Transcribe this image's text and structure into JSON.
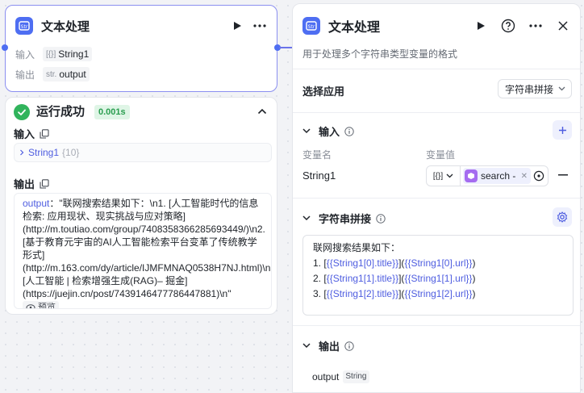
{
  "colors": {
    "accent": "#4e6ef2",
    "success": "#31b45c",
    "plugin": "#a56cf0"
  },
  "node": {
    "title": "文本处理",
    "input_label": "输入",
    "input_type": "[{}]",
    "input_value": "String1",
    "output_label": "输出",
    "output_type": "str.",
    "output_value": "output"
  },
  "result": {
    "status": "运行成功",
    "duration": "0.001s",
    "input_title": "输入",
    "input_key": "String1",
    "input_count": "{10}",
    "output_title": "输出",
    "output_key": "output",
    "output_sep": "：",
    "output_value": "\"联网搜索结果如下：\\n1. [人工智能时代的信息检索: 应用现状、现实挑战与应对策略](http://m.toutiao.com/group/7408358366285693449/)\\n2. [基于教育元宇宙的AI人工智能检索平台变革了传统教学形式](http://m.163.com/dy/article/IJMFMNAQ0538H7NJ.html)\\n3. [人工智能 | 检索增强生成(RAG)– 掘金](https://juejin.cn/post/7439146477786447881)\\n\"",
    "preview_label": "预览"
  },
  "panel": {
    "title": "文本处理",
    "description": "用于处理多个字符串类型变量的格式",
    "apply_label": "选择应用",
    "apply_value": "字符串拼接",
    "input_section": "输入",
    "col_name": "变量名",
    "col_value": "变量值",
    "var_name": "String1",
    "var_type": "[{}]",
    "var_ref": "search - out",
    "concat_section": "字符串拼接",
    "template": [
      {
        "pre": "联网搜索结果如下：",
        "v1": "",
        "mid": "",
        "v2": "",
        "post": ""
      },
      {
        "pre": "1. [",
        "v1": "{{String1[0].title}}",
        "mid": "](",
        "v2": "{{String1[0].url}}",
        "post": ")"
      },
      {
        "pre": "2. [",
        "v1": "{{String1[1].title}}",
        "mid": "](",
        "v2": "{{String1[1].url}}",
        "post": ")"
      },
      {
        "pre": "3. [",
        "v1": "{{String1[2].title}}",
        "mid": "](",
        "v2": "{{String1[2].url}}",
        "post": ")"
      }
    ],
    "output_section": "输出",
    "output_name": "output",
    "output_type": "String"
  }
}
